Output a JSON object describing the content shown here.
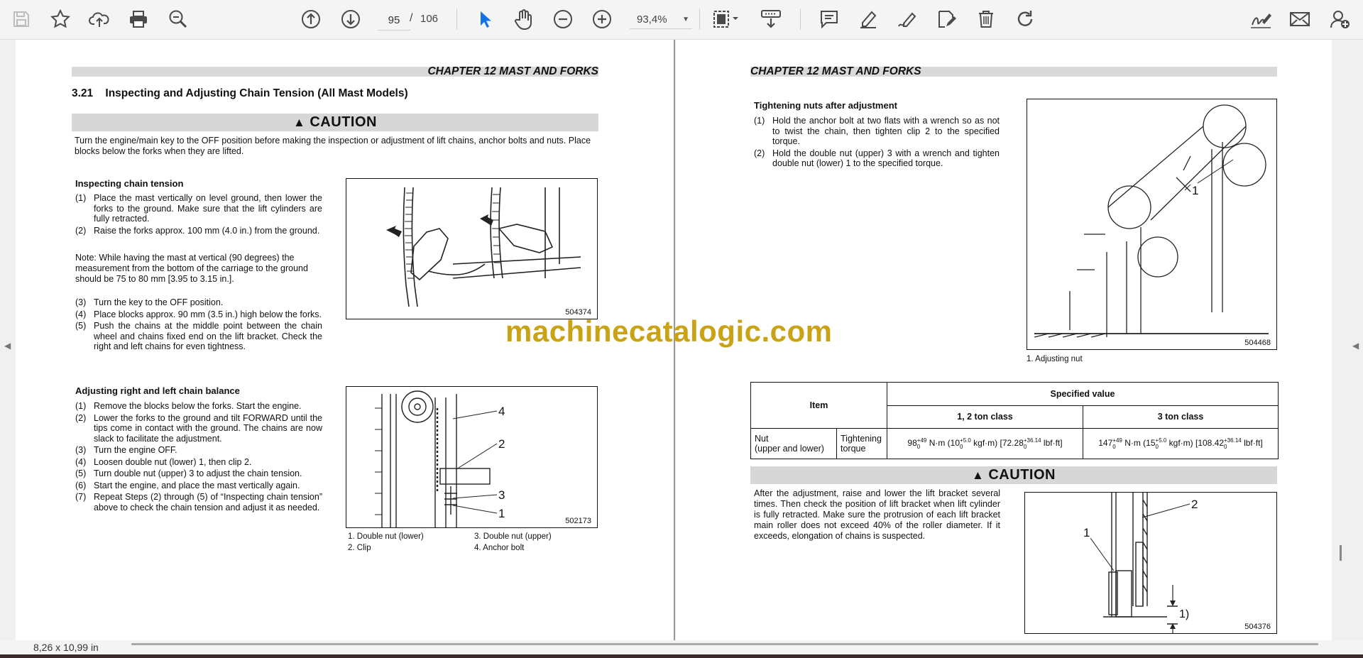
{
  "toolbar": {
    "left_icons": [
      "save-icon",
      "bookmark-star-icon",
      "upload-cloud-icon",
      "print-icon",
      "zoom-out-search-icon"
    ],
    "nav_icons": [
      "page-up-icon",
      "page-down-icon"
    ],
    "page_current": "95",
    "page_separator": "/",
    "page_total": "106",
    "tool_icons": [
      "select-pointer-icon",
      "hand-pan-icon",
      "zoom-minus-icon",
      "zoom-plus-icon"
    ],
    "zoom_value": "93,4%",
    "right_icons": [
      "fit-page-icon",
      "download-scroll-icon",
      "comment-icon",
      "highlight-pen-icon",
      "draw-pen-icon",
      "edit-icon",
      "delete-icon",
      "rotate-icon",
      "sign-icon",
      "email-icon",
      "share-user-icon"
    ]
  },
  "left_page": {
    "chapter": "CHAPTER 12 MAST AND FORKS",
    "section_title": "3.21    Inspecting and Adjusting Chain Tension (All Mast Models)",
    "caution_label": "CAUTION",
    "caution_text": "Turn the engine/main key to the OFF position before making the inspection or adjustment of lift chains, anchor bolts and nuts. Place blocks below the forks when they are lifted.",
    "inspect_heading": "Inspecting chain tension",
    "inspect_steps": [
      {
        "n": "(1)",
        "t": "Place the mast vertically on level ground, then lower the forks to the ground.  Make sure that the lift cylinders are fully retracted."
      },
      {
        "n": "(2)",
        "t": "Raise the forks approx.  100 mm (4.0 in.) from the ground."
      }
    ],
    "inspect_note": "Note: While having the mast at vertical (90 degrees) the measurement from the bottom of the carriage to the ground should be 75 to 80 mm [3.95 to 3.15 in.].",
    "inspect_steps_2": [
      {
        "n": "(3)",
        "t": "Turn the key to the OFF position."
      },
      {
        "n": "(4)",
        "t": "Place blocks approx.  90 mm (3.5 in.) high below the forks."
      },
      {
        "n": "(5)",
        "t": "Push the chains at the middle point between the chain wheel and chains fixed end on the lift bracket.  Check the right and left chains for even tightness."
      }
    ],
    "fig1_code": "504374",
    "adjust_heading": "Adjusting right and left chain balance",
    "adjust_steps": [
      {
        "n": "(1)",
        "t": "Remove the blocks below the forks.  Start the engine."
      },
      {
        "n": "(2)",
        "t": "Lower the forks to the ground and tilt FORWARD until the tips come in contact with the ground.  The chains are now slack to facilitate the adjustment."
      },
      {
        "n": "(3)",
        "t": "Turn the engine OFF."
      },
      {
        "n": "(4)",
        "t": "Loosen double nut (lower)  1, then clip 2."
      },
      {
        "n": "(5)",
        "t": "Turn double nut (upper)  3 to adjust the chain tension."
      },
      {
        "n": "(6)",
        "t": "Start the engine, and place the mast vertically again."
      },
      {
        "n": "(7)",
        "t": "Repeat Steps (2) through (5) of “Inspecting chain tension” above to check the chain tension and adjust it as needed."
      }
    ],
    "fig2_code": "502173",
    "fig2_callouts": [
      "4",
      "2",
      "3",
      "1"
    ],
    "fig2_captions": [
      "1. Double nut (lower)",
      "2. Clip",
      "3. Double nut (upper)",
      "4. Anchor bolt"
    ]
  },
  "right_page": {
    "chapter": "CHAPTER 12 MAST AND FORKS",
    "tighten_heading": "Tightening nuts after adjustment",
    "tighten_steps": [
      {
        "n": "(1)",
        "t": "Hold the anchor bolt at two flats with a wrench so as not to twist the chain, then tighten clip 2 to the specified torque."
      },
      {
        "n": "(2)",
        "t": "Hold the double nut (upper)  3 with a wrench and tighten double nut (lower)  1 to the specified torque."
      }
    ],
    "fig3_code": "504468",
    "fig3_callout": "1",
    "fig3_caption": "1. Adjusting nut",
    "table": {
      "item_header": "Item",
      "spec_header": "Specified value",
      "class_a": "1, 2 ton class",
      "class_b": "3 ton class",
      "row_item": "Nut\n(upper and lower)",
      "row_sub": "Tightening\ntorque",
      "val_a_main": "98",
      "val_a_sup": "+49",
      "val_a_sub": "0",
      "val_a_mid": "N·m (10",
      "val_a_sup2": "+5.0",
      "val_a_sub2": "0",
      "val_a_mid2": "kgf·m) [72.28",
      "val_a_sup3": "+36.14",
      "val_a_sub3": "0",
      "val_a_end": "lbf·ft]",
      "val_b_main": "147",
      "val_b_sup": "+49",
      "val_b_sub": "0",
      "val_b_mid": "N·m (15",
      "val_b_sup2": "+5.0",
      "val_b_sub2": "0",
      "val_b_mid2": "kgf·m) [108.42",
      "val_b_sup3": "+36.14",
      "val_b_sub3": "0",
      "val_b_end": "lbf·ft]"
    },
    "caution_label": "CAUTION",
    "caution_text": "After the adjustment, raise and lower the lift bracket several times.  Then check the position of lift bracket when lift cylinder is fully retracted. Make sure the protrusion of each lift bracket main roller does not exceed 40% of the roller diameter.  If it exceeds, elongation of chains is suspected.",
    "fig4_code": "504376",
    "fig4_callouts": [
      "2",
      "1",
      "1)"
    ]
  },
  "watermark": "machinecatalogic.com",
  "status": {
    "page_size": "8,26 x 10,99 in"
  },
  "colors": {
    "accent": "#1473e6",
    "watermark": "#c9a215",
    "caution_bar": "#d7d7d7"
  }
}
